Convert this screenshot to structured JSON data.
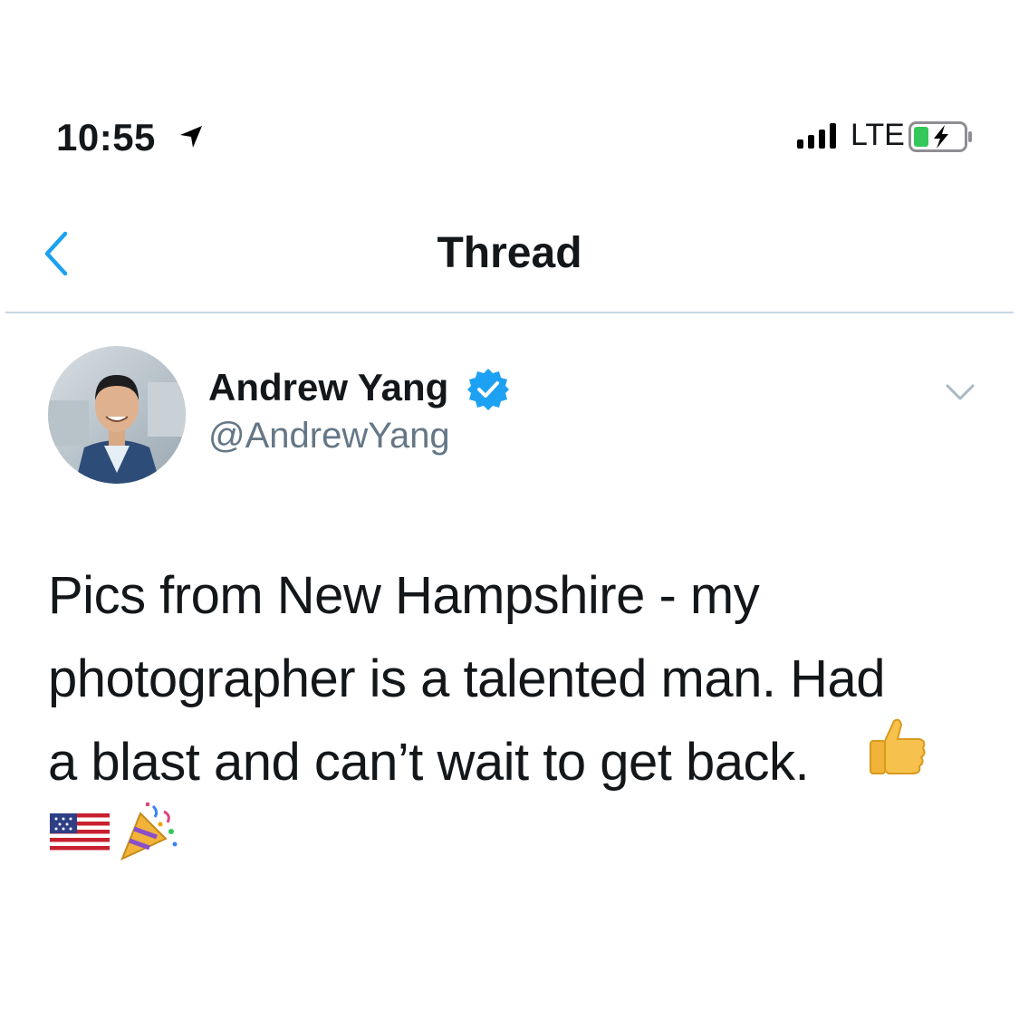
{
  "status_bar": {
    "time": "10:55",
    "network": "LTE",
    "location_icon": "location-arrow-icon",
    "battery_icon": "battery-charging-icon"
  },
  "nav": {
    "title": "Thread",
    "back_icon": "chevron-left-icon"
  },
  "tweet": {
    "author_name": "Andrew Yang",
    "handle": "@AndrewYang",
    "verified": true,
    "text_lines": [
      "Pics from New Hampshire - my",
      "photographer is a talented man.  Had",
      "a blast and can’t wait to get back."
    ],
    "emojis": [
      "thumbs-up",
      "us-flag",
      "party-popper"
    ]
  },
  "colors": {
    "accent": "#1da1f2",
    "text": "#14171a",
    "secondary": "#657786",
    "divider": "#c8d6e3"
  }
}
